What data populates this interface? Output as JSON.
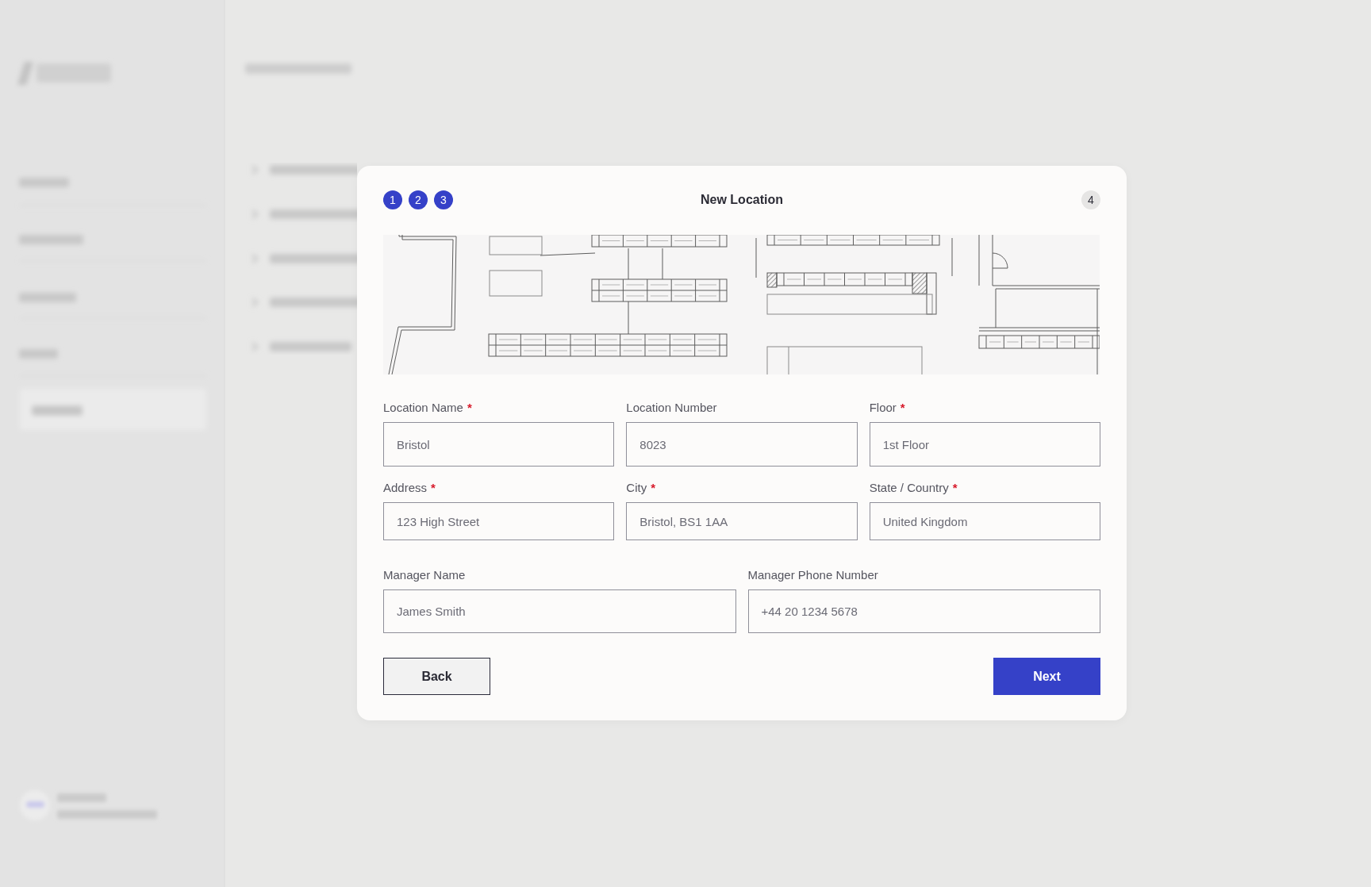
{
  "modal": {
    "title": "New Location",
    "steps": [
      {
        "label": "1",
        "completed": true
      },
      {
        "label": "2",
        "completed": true
      },
      {
        "label": "3",
        "completed": true
      },
      {
        "label": "4",
        "completed": false
      }
    ],
    "required_mark": "*",
    "rows": [
      [
        {
          "label": "Location Name",
          "required": true,
          "value": "Bristol"
        },
        {
          "label": "Location Number",
          "required": false,
          "value": "8023"
        },
        {
          "label": "Floor",
          "required": true,
          "value": "1st Floor"
        }
      ],
      [
        {
          "label": "Address",
          "required": true,
          "value": "123 High Street"
        },
        {
          "label": "City",
          "required": true,
          "value": "Bristol, BS1 1AA"
        },
        {
          "label": "State / Country",
          "required": true,
          "value": "United Kingdom"
        }
      ],
      [
        {
          "label": "Manager Name",
          "required": false,
          "value": "James Smith"
        },
        {
          "label": "Manager Phone Number",
          "required": false,
          "value": "+44 20 1234 5678"
        }
      ]
    ],
    "buttons": [
      {
        "label": "Back",
        "kind": "secondary"
      },
      {
        "label": "Next",
        "kind": "primary"
      }
    ]
  }
}
